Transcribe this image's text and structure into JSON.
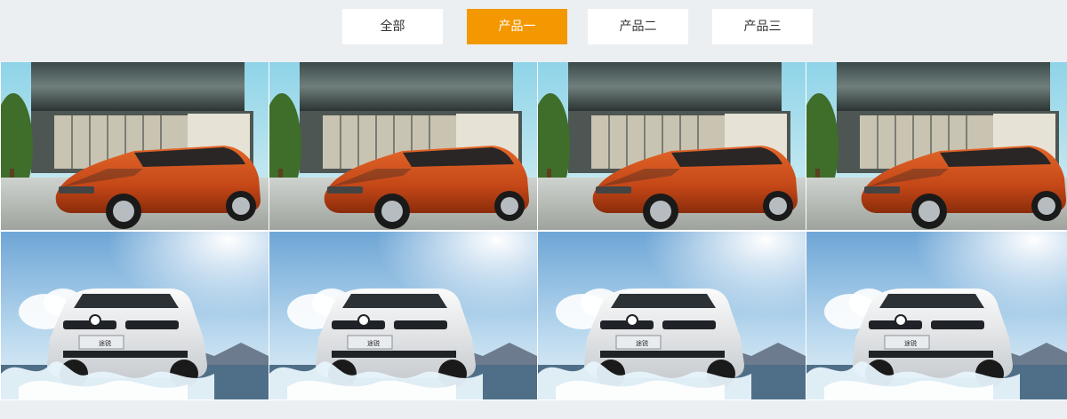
{
  "filter_tabs": [
    {
      "label": "全部",
      "active": false
    },
    {
      "label": "产品一",
      "active": true
    },
    {
      "label": "产品二",
      "active": false
    },
    {
      "label": "产品三",
      "active": false
    }
  ],
  "colors": {
    "accent": "#f39800",
    "page_background": "#eceff2",
    "tab_background": "#ffffff",
    "tab_text": "#333333"
  },
  "gallery": {
    "rows": [
      {
        "kind": "orange-hatchback-photo",
        "count": 4
      },
      {
        "kind": "white-suv-splash-photo",
        "count": 4
      }
    ],
    "suv_plate_text": "途锐"
  }
}
